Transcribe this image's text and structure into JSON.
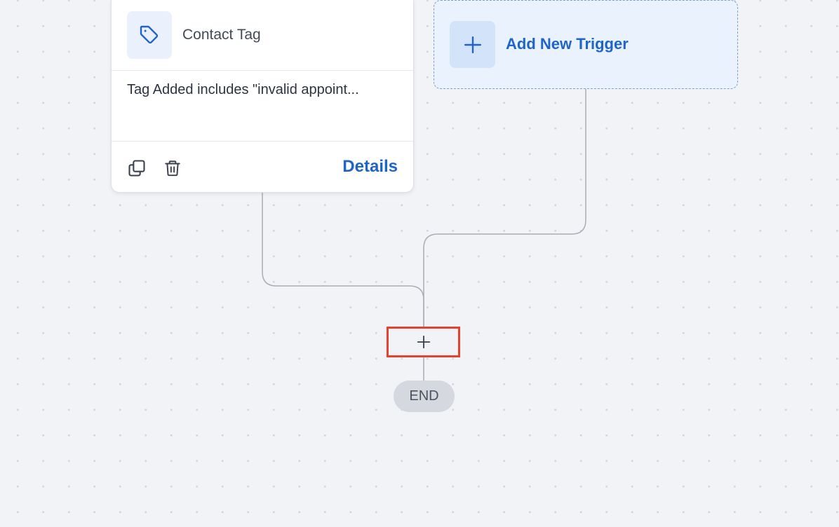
{
  "trigger_card": {
    "icon": "tag-icon",
    "title": "Contact Tag",
    "description": "Tag Added includes \"invalid appoint...",
    "copy_icon": "copy-icon",
    "delete_icon": "trash-icon",
    "details_label": "Details"
  },
  "add_trigger": {
    "icon": "plus-icon",
    "label": "Add New Trigger"
  },
  "add_action": {
    "icon": "plus-icon"
  },
  "end_label": "END",
  "colors": {
    "accent": "#1f64c8",
    "canvas_bg": "#f2f3f6",
    "highlight": "#e8412f",
    "end_pill": "#d5d8de"
  }
}
